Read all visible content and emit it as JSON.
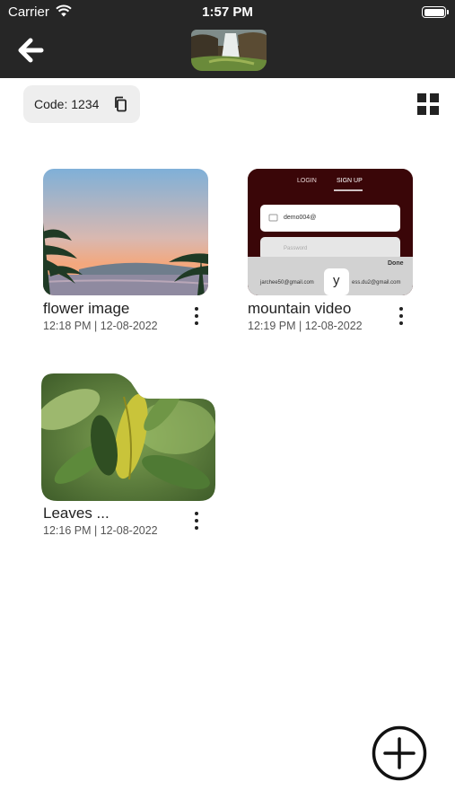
{
  "status_bar": {
    "carrier": "Carrier",
    "time": "1:57 PM"
  },
  "header": {
    "back_icon": "arrow-left-icon",
    "thumbnail_icon": "waterfall-photo-thumbnail"
  },
  "toolbar": {
    "code_label": "Code: 1234",
    "copy_icon": "copy-icon",
    "view_toggle_icon": "grid-view-icon"
  },
  "items": [
    {
      "title": "flower image",
      "meta": "12:18 PM | 12-08-2022",
      "thumb_type": "image",
      "more_icon": "vertical-dots-icon"
    },
    {
      "title": "mountain video",
      "meta": "12:19 PM | 12-08-2022",
      "thumb_type": "video",
      "more_icon": "vertical-dots-icon",
      "preview": {
        "tab_login": "LOGIN",
        "tab_signup": "SIGN UP",
        "email_value": "demo004@",
        "password_placeholder": "Password",
        "done_label": "Done",
        "suggestion_left": "jarchee50@gmail.com",
        "suggestion_right": "ess.du2@gmail.com",
        "key_popup": "y"
      }
    },
    {
      "title": "Leaves ...",
      "meta": "12:16 PM | 12-08-2022",
      "thumb_type": "image",
      "more_icon": "vertical-dots-icon"
    }
  ],
  "fab": {
    "icon": "add-circle-icon"
  }
}
